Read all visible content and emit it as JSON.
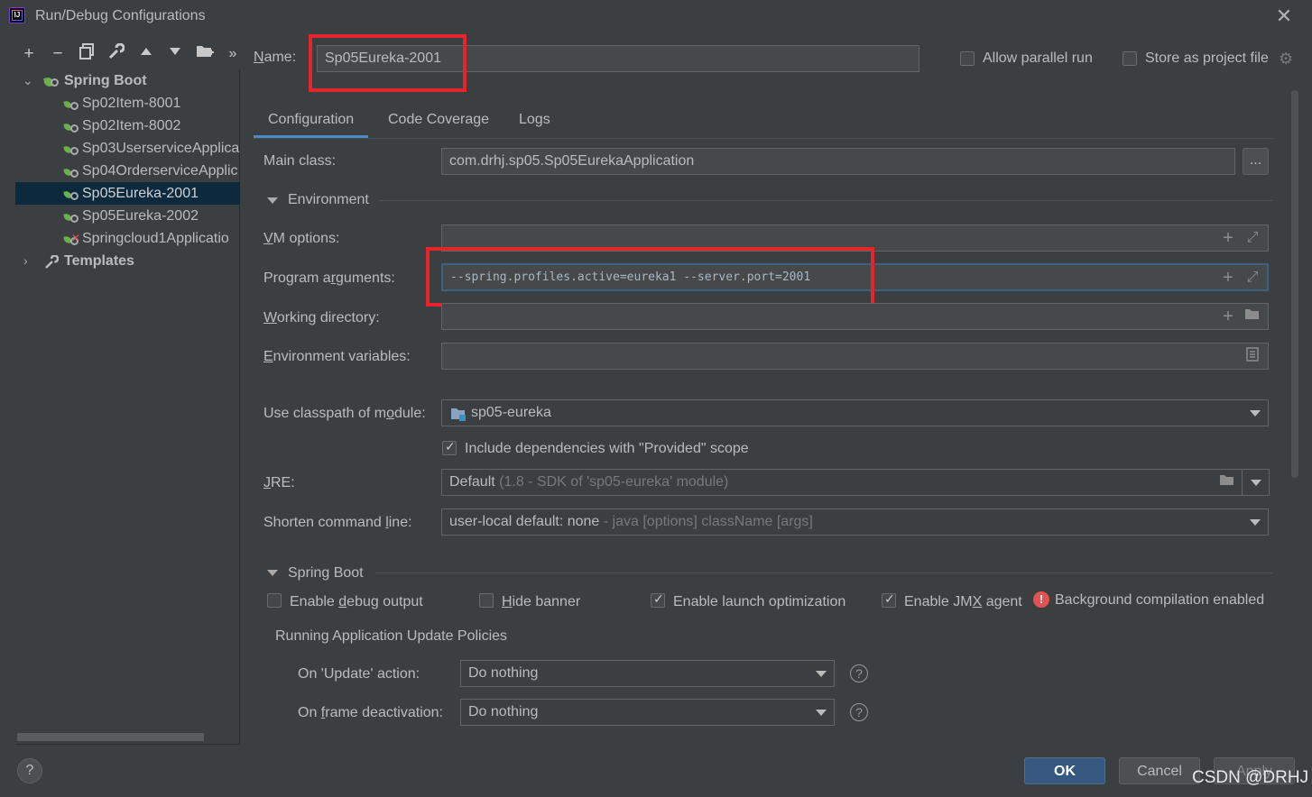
{
  "window": {
    "title": "Run/Debug Configurations"
  },
  "toolbar": {
    "add": "+",
    "remove": "−",
    "copy": "⧉",
    "edit": "🔧",
    "up": "▲",
    "down": "▼",
    "folder": "▆",
    "more": "»"
  },
  "tree": {
    "root_label": "Spring Boot",
    "items": [
      {
        "label": "Sp02Item-8001"
      },
      {
        "label": "Sp02Item-8002"
      },
      {
        "label": "Sp03UserserviceApplica"
      },
      {
        "label": "Sp04OrderserviceApplic"
      },
      {
        "label": "Sp05Eureka-2001"
      },
      {
        "label": "Sp05Eureka-2002"
      },
      {
        "label": "Springcloud1Applicatio"
      }
    ],
    "templates_label": "Templates"
  },
  "header": {
    "name_label": "Name:",
    "name_value": "Sp05Eureka-2001",
    "allow_parallel_label": "Allow parallel run",
    "store_as_project_label": "Store as project file"
  },
  "tabs": [
    {
      "label": "Configuration"
    },
    {
      "label": "Code Coverage"
    },
    {
      "label": "Logs"
    }
  ],
  "config": {
    "main_class_label": "Main class:",
    "main_class_value": "com.drhj.sp05.Sp05EurekaApplication",
    "browse_label": "...",
    "environment_label": "Environment",
    "vm_options_label": "VM options:",
    "program_args_label": "Program arguments:",
    "program_args_value": "--spring.profiles.active=eureka1 --server.port=2001",
    "working_dir_label": "Working directory:",
    "env_vars_label": "Environment variables:",
    "classpath_label": "Use classpath of module:",
    "classpath_value": "sp05-eureka",
    "include_deps_label": "Include dependencies with \"Provided\" scope",
    "jre_label": "JRE:",
    "jre_value": "Default",
    "jre_hint": "(1.8 - SDK of 'sp05-eureka' module)",
    "shorten_label": "Shorten command line:",
    "shorten_value": "user-local default: none",
    "shorten_hint": "- java [options] className [args]",
    "spring_boot_label": "Spring Boot",
    "debug_output_label": "Enable debug output",
    "hide_banner_label": "Hide banner",
    "launch_opt_label": "Enable launch optimization",
    "jmx_label": "Enable JMX agent",
    "bg_compilation_label": "Background compilation enabled",
    "policies_label": "Running Application Update Policies",
    "on_update_label": "On 'Update' action:",
    "on_update_value": "Do nothing",
    "on_frame_label": "On frame deactivation:",
    "on_frame_value": "Do nothing"
  },
  "footer": {
    "help": "?",
    "ok_label": "OK",
    "cancel_label": "Cancel",
    "apply_label": "Apply",
    "watermark": "CSDN @DRHJ"
  },
  "colors": {
    "background": "#3c3f41",
    "field": "#45494a",
    "accent": "#4a88c7",
    "ok_button": "#365880",
    "annotation": "#e8242b",
    "selected_row": "#0d293e"
  }
}
